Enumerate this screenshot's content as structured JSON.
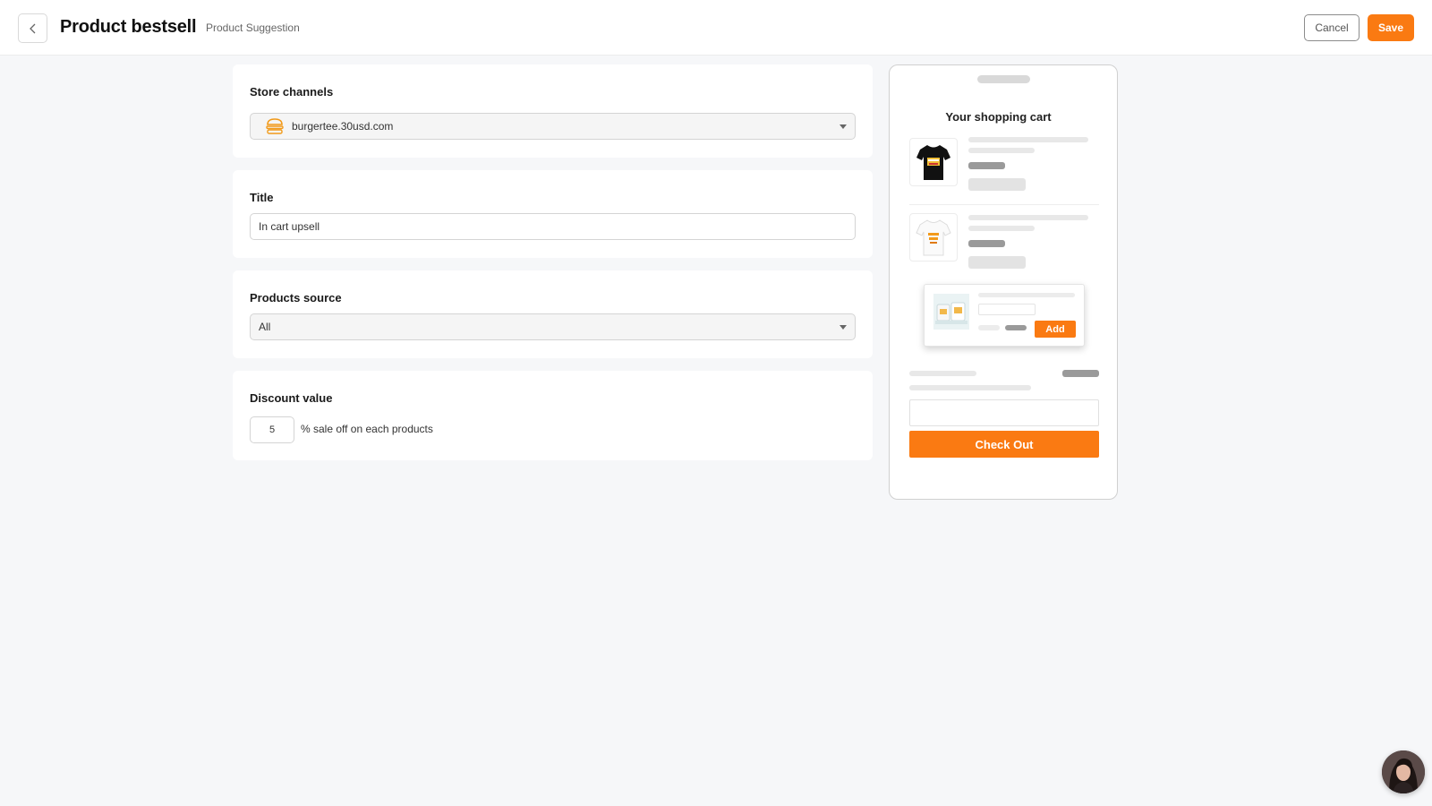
{
  "header": {
    "title": "Product bestsell",
    "subtitle": "Product Suggestion",
    "cancel_label": "Cancel",
    "save_label": "Save"
  },
  "form": {
    "store_channels": {
      "label": "Store channels",
      "value": "burgertee.30usd.com",
      "icon": "burger-icon"
    },
    "title": {
      "label": "Title",
      "value": "In cart upsell"
    },
    "products_source": {
      "label": "Products source",
      "value": "All"
    },
    "discount": {
      "label": "Discount value",
      "value": "5",
      "suffix": "% sale off on each products"
    }
  },
  "preview": {
    "cart_title": "Your shopping cart",
    "add_label": "Add",
    "checkout_label": "Check Out"
  },
  "colors": {
    "accent": "#fa7a12",
    "background": "#f6f7f9"
  }
}
